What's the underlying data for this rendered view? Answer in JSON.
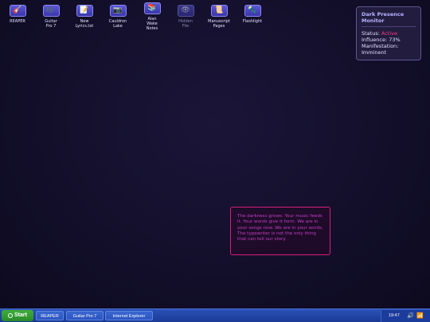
{
  "desktop_icons": [
    {
      "label": "REAPER",
      "icon": "guitar-icon",
      "glyph": "🎸"
    },
    {
      "label": "Guitar\nPro 7",
      "icon": "sheet-music-icon",
      "glyph": "🎼"
    },
    {
      "label": "New\nLyrics.txt",
      "icon": "notepad-icon",
      "glyph": "📝"
    },
    {
      "label": "Cauldron\nLake",
      "icon": "camera-icon",
      "glyph": "📷"
    },
    {
      "label": "Alan\nWake\nNotes",
      "icon": "books-icon",
      "glyph": "📚"
    },
    {
      "label": "Hidden\nFile",
      "icon": "eye-icon",
      "glyph": "👁"
    },
    {
      "label": "Manuscript\nPages",
      "icon": "scroll-icon",
      "glyph": "📜"
    },
    {
      "label": "Flashlight",
      "icon": "flashlight-icon",
      "glyph": "🔦"
    }
  ],
  "monitor": {
    "title": "Dark Presence Monitor",
    "status_label": "Status:",
    "status_value": "Active",
    "influence": "Influence: 73%",
    "manifestation_label": "Manifestation:",
    "manifestation_value": "Imminent"
  },
  "message": {
    "line1": "The darkness grows. Your music feeds it. Your words give it form. We are in your songs now. We are in your words.",
    "line2": "The typewriter is not the only thing that can tell our story."
  },
  "taskbar": {
    "start_label": "Start",
    "tasks": [
      "REAPER",
      "Guitar Pro 7",
      "Internet Explorer"
    ],
    "clock": "19:47"
  },
  "colors": {
    "desktop": "#130f2b",
    "accent": "#d61f7a",
    "status_active": "#ff3c7e",
    "taskbar": "#1b3a96"
  }
}
